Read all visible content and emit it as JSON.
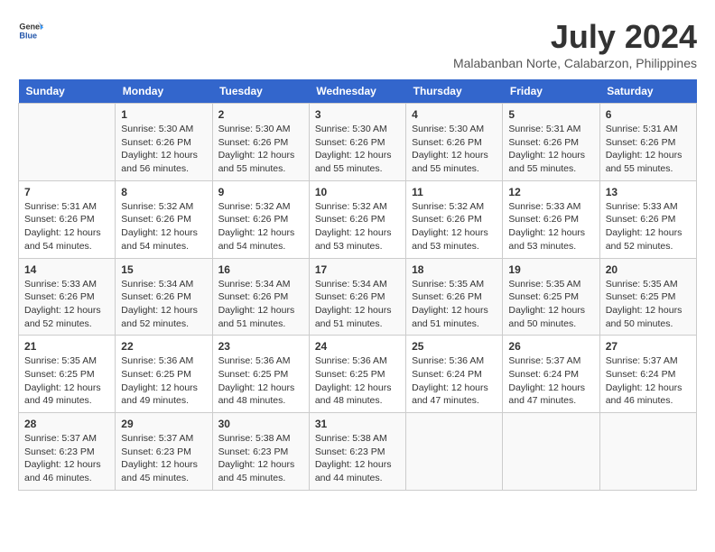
{
  "header": {
    "logo_general": "General",
    "logo_blue": "Blue",
    "title": "July 2024",
    "subtitle": "Malabanban Norte, Calabarzon, Philippines"
  },
  "weekdays": [
    "Sunday",
    "Monday",
    "Tuesday",
    "Wednesday",
    "Thursday",
    "Friday",
    "Saturday"
  ],
  "weeks": [
    [
      {
        "day": "",
        "info": ""
      },
      {
        "day": "1",
        "info": "Sunrise: 5:30 AM\nSunset: 6:26 PM\nDaylight: 12 hours\nand 56 minutes."
      },
      {
        "day": "2",
        "info": "Sunrise: 5:30 AM\nSunset: 6:26 PM\nDaylight: 12 hours\nand 55 minutes."
      },
      {
        "day": "3",
        "info": "Sunrise: 5:30 AM\nSunset: 6:26 PM\nDaylight: 12 hours\nand 55 minutes."
      },
      {
        "day": "4",
        "info": "Sunrise: 5:30 AM\nSunset: 6:26 PM\nDaylight: 12 hours\nand 55 minutes."
      },
      {
        "day": "5",
        "info": "Sunrise: 5:31 AM\nSunset: 6:26 PM\nDaylight: 12 hours\nand 55 minutes."
      },
      {
        "day": "6",
        "info": "Sunrise: 5:31 AM\nSunset: 6:26 PM\nDaylight: 12 hours\nand 55 minutes."
      }
    ],
    [
      {
        "day": "7",
        "info": "Sunrise: 5:31 AM\nSunset: 6:26 PM\nDaylight: 12 hours\nand 54 minutes."
      },
      {
        "day": "8",
        "info": "Sunrise: 5:32 AM\nSunset: 6:26 PM\nDaylight: 12 hours\nand 54 minutes."
      },
      {
        "day": "9",
        "info": "Sunrise: 5:32 AM\nSunset: 6:26 PM\nDaylight: 12 hours\nand 54 minutes."
      },
      {
        "day": "10",
        "info": "Sunrise: 5:32 AM\nSunset: 6:26 PM\nDaylight: 12 hours\nand 53 minutes."
      },
      {
        "day": "11",
        "info": "Sunrise: 5:32 AM\nSunset: 6:26 PM\nDaylight: 12 hours\nand 53 minutes."
      },
      {
        "day": "12",
        "info": "Sunrise: 5:33 AM\nSunset: 6:26 PM\nDaylight: 12 hours\nand 53 minutes."
      },
      {
        "day": "13",
        "info": "Sunrise: 5:33 AM\nSunset: 6:26 PM\nDaylight: 12 hours\nand 52 minutes."
      }
    ],
    [
      {
        "day": "14",
        "info": "Sunrise: 5:33 AM\nSunset: 6:26 PM\nDaylight: 12 hours\nand 52 minutes."
      },
      {
        "day": "15",
        "info": "Sunrise: 5:34 AM\nSunset: 6:26 PM\nDaylight: 12 hours\nand 52 minutes."
      },
      {
        "day": "16",
        "info": "Sunrise: 5:34 AM\nSunset: 6:26 PM\nDaylight: 12 hours\nand 51 minutes."
      },
      {
        "day": "17",
        "info": "Sunrise: 5:34 AM\nSunset: 6:26 PM\nDaylight: 12 hours\nand 51 minutes."
      },
      {
        "day": "18",
        "info": "Sunrise: 5:35 AM\nSunset: 6:26 PM\nDaylight: 12 hours\nand 51 minutes."
      },
      {
        "day": "19",
        "info": "Sunrise: 5:35 AM\nSunset: 6:25 PM\nDaylight: 12 hours\nand 50 minutes."
      },
      {
        "day": "20",
        "info": "Sunrise: 5:35 AM\nSunset: 6:25 PM\nDaylight: 12 hours\nand 50 minutes."
      }
    ],
    [
      {
        "day": "21",
        "info": "Sunrise: 5:35 AM\nSunset: 6:25 PM\nDaylight: 12 hours\nand 49 minutes."
      },
      {
        "day": "22",
        "info": "Sunrise: 5:36 AM\nSunset: 6:25 PM\nDaylight: 12 hours\nand 49 minutes."
      },
      {
        "day": "23",
        "info": "Sunrise: 5:36 AM\nSunset: 6:25 PM\nDaylight: 12 hours\nand 48 minutes."
      },
      {
        "day": "24",
        "info": "Sunrise: 5:36 AM\nSunset: 6:25 PM\nDaylight: 12 hours\nand 48 minutes."
      },
      {
        "day": "25",
        "info": "Sunrise: 5:36 AM\nSunset: 6:24 PM\nDaylight: 12 hours\nand 47 minutes."
      },
      {
        "day": "26",
        "info": "Sunrise: 5:37 AM\nSunset: 6:24 PM\nDaylight: 12 hours\nand 47 minutes."
      },
      {
        "day": "27",
        "info": "Sunrise: 5:37 AM\nSunset: 6:24 PM\nDaylight: 12 hours\nand 46 minutes."
      }
    ],
    [
      {
        "day": "28",
        "info": "Sunrise: 5:37 AM\nSunset: 6:23 PM\nDaylight: 12 hours\nand 46 minutes."
      },
      {
        "day": "29",
        "info": "Sunrise: 5:37 AM\nSunset: 6:23 PM\nDaylight: 12 hours\nand 45 minutes."
      },
      {
        "day": "30",
        "info": "Sunrise: 5:38 AM\nSunset: 6:23 PM\nDaylight: 12 hours\nand 45 minutes."
      },
      {
        "day": "31",
        "info": "Sunrise: 5:38 AM\nSunset: 6:23 PM\nDaylight: 12 hours\nand 44 minutes."
      },
      {
        "day": "",
        "info": ""
      },
      {
        "day": "",
        "info": ""
      },
      {
        "day": "",
        "info": ""
      }
    ]
  ]
}
